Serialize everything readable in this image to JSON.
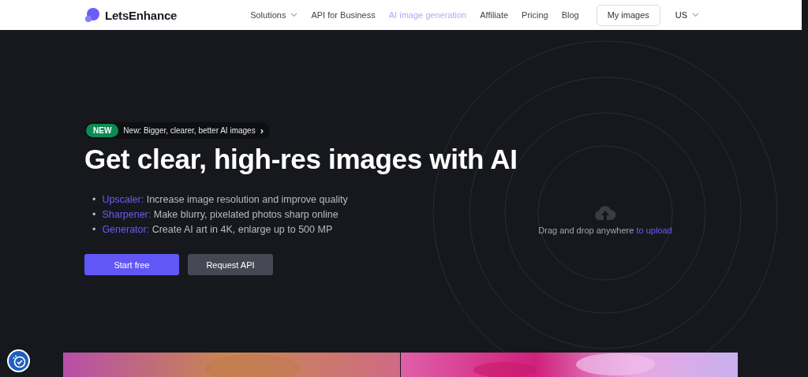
{
  "header": {
    "logo": "LetsEnhance",
    "nav": [
      {
        "label": "Solutions",
        "selected": false,
        "dropdown": true
      },
      {
        "label": "API for Business",
        "selected": false,
        "dropdown": false
      },
      {
        "label": "AI image generation",
        "selected": true,
        "dropdown": false
      },
      {
        "label": "Affiliate",
        "selected": false,
        "dropdown": false
      },
      {
        "label": "Pricing",
        "selected": false,
        "dropdown": false
      },
      {
        "label": "Blog",
        "selected": false,
        "dropdown": false
      }
    ],
    "my_images_button": "My images",
    "language": "US"
  },
  "hero": {
    "badge": {
      "tag": "NEW",
      "text": "New: Bigger, clearer, better AI images",
      "arrow": "›"
    },
    "title": "Get clear, high-res images with AI",
    "features": [
      {
        "bullet": "•",
        "label": "Upscaler:",
        "text": "Increase image resolution and improve quality"
      },
      {
        "bullet": "•",
        "label": "Sharpener:",
        "text": "Make blurry, pixelated photos sharp online"
      },
      {
        "bullet": "•",
        "label": "Generator:",
        "text": "Create AI art in 4K, enlarge up to 500 MP"
      }
    ],
    "primary_button": "Start free",
    "secondary_button": "Request API",
    "upload": {
      "text": "Drag and drop anywhere",
      "link": "to upload"
    }
  }
}
